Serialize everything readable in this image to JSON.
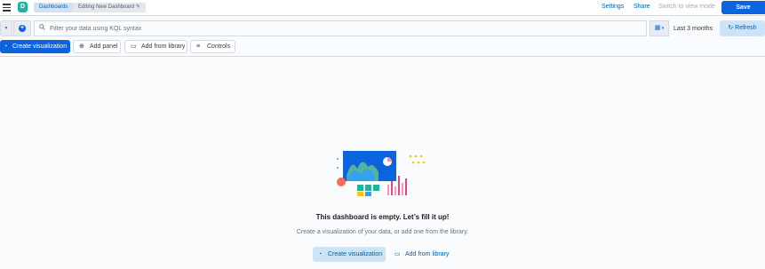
{
  "header": {
    "breadcrumbs": [
      "Dashboards",
      "Editing New Dashboard"
    ],
    "space_initial": "D",
    "settings_label": "Settings",
    "share_label": "Share",
    "switch_label": "Switch to view mode",
    "save_label": "Save"
  },
  "query": {
    "placeholder": "Filter your data using KQL syntax",
    "date_range": "Last 3 months",
    "refresh_label": "Refresh"
  },
  "toolbar": {
    "create_label": "Create visualization",
    "add_panel_label": "Add panel",
    "add_library_label": "Add from library",
    "controls_label": "Controls"
  },
  "empty_state": {
    "title": "This dashboard is empty. Let’s fill it up!",
    "description": "Create a visualization of your data, or add one from the library.",
    "create_label": "Create visualization",
    "library_label": "Add from library"
  },
  "colors": {
    "primary": "#0b64dd",
    "link": "#0061a6",
    "space_avatar": "#20b49e"
  }
}
